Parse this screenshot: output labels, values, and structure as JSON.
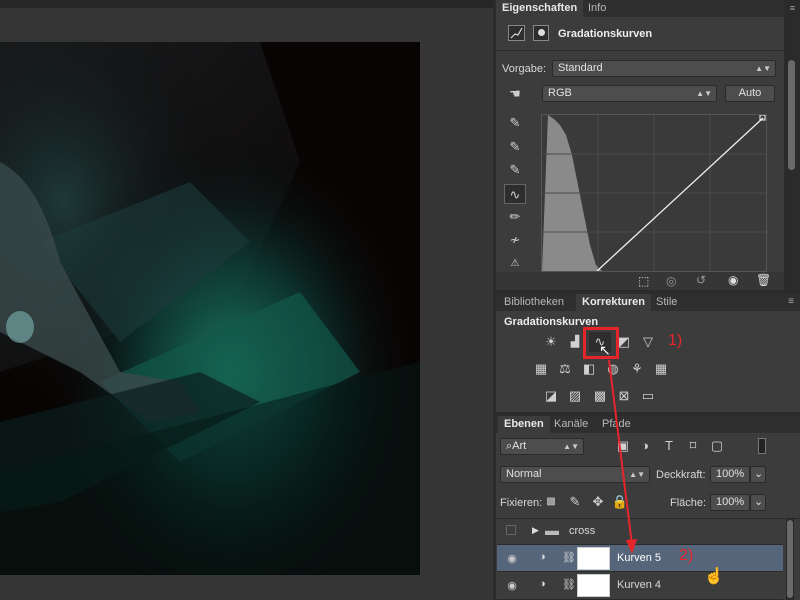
{
  "properties_panel": {
    "tabs": [
      "Eigenschaften",
      "Info"
    ],
    "title": "Gradationskurven",
    "preset_label": "Vorgabe:",
    "preset_value": "Standard",
    "channel_value": "RGB",
    "auto_label": "Auto"
  },
  "adjustments_panel": {
    "tabs": [
      "Bibliotheken",
      "Korrekturen",
      "Stile"
    ],
    "title": "Gradationskurven",
    "annotation_1": "1)"
  },
  "layers_panel": {
    "tabs": [
      "Ebenen",
      "Kanäle",
      "Pfade"
    ],
    "filter_value": "Art",
    "blend_mode": "Normal",
    "opacity_label": "Deckkraft:",
    "opacity_value": "100%",
    "lock_label": "Fixieren:",
    "fill_label": "Fläche:",
    "fill_value": "100%",
    "layers": [
      {
        "name": "cross",
        "type": "group"
      },
      {
        "name": "Kurven 5",
        "type": "curves"
      },
      {
        "name": "Kurven 4",
        "type": "curves"
      }
    ],
    "annotation_2": "2)"
  },
  "colors": {
    "annotation": "#e5252a",
    "selected_row": "#56657a"
  }
}
